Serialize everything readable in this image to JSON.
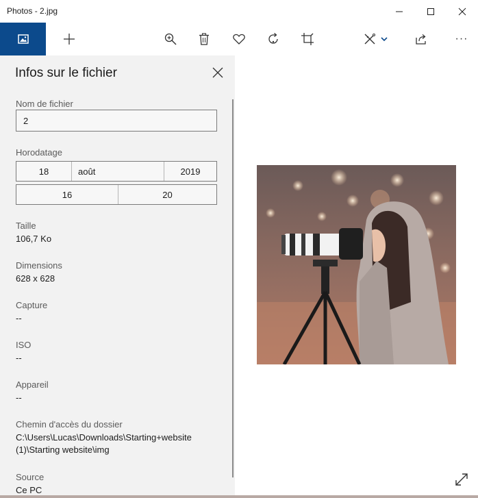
{
  "window": {
    "title": "Photos - 2.jpg",
    "buttons": [
      "minimize-icon",
      "maximize-icon",
      "close-icon"
    ]
  },
  "toolbar": {
    "icons": [
      "image-icon",
      "add-icon",
      "zoom-in-icon",
      "delete-icon",
      "favorite-icon",
      "rotate-icon",
      "crop-icon",
      "edit-icon",
      "chevron-down-icon",
      "share-icon",
      "more-icon"
    ],
    "more_label": "···",
    "accent_color": "#0c4a8c"
  },
  "panel": {
    "title": "Infos sur le fichier",
    "filename_label": "Nom de fichier",
    "filename_value": "2",
    "timestamp_label": "Horodatage",
    "date": {
      "day": "18",
      "month": "août",
      "year": "2019"
    },
    "time": {
      "hour": "16",
      "minute": "20"
    },
    "size_label": "Taille",
    "size_value": "106,7 Ko",
    "dimensions_label": "Dimensions",
    "dimensions_value": "628 x 628",
    "capture_label": "Capture",
    "capture_value": "--",
    "iso_label": "ISO",
    "iso_value": "--",
    "device_label": "Appareil",
    "device_value": "--",
    "path_label": "Chemin d'accès du dossier",
    "path_value_line1": "C:\\Users\\Lucas\\Downloads\\Starting+website",
    "path_value_line2": "(1)\\Starting website\\img",
    "source_label": "Source",
    "source_value": "Ce PC"
  },
  "viewer": {
    "photo_description": "photo-woman-with-camera-on-tripod"
  }
}
